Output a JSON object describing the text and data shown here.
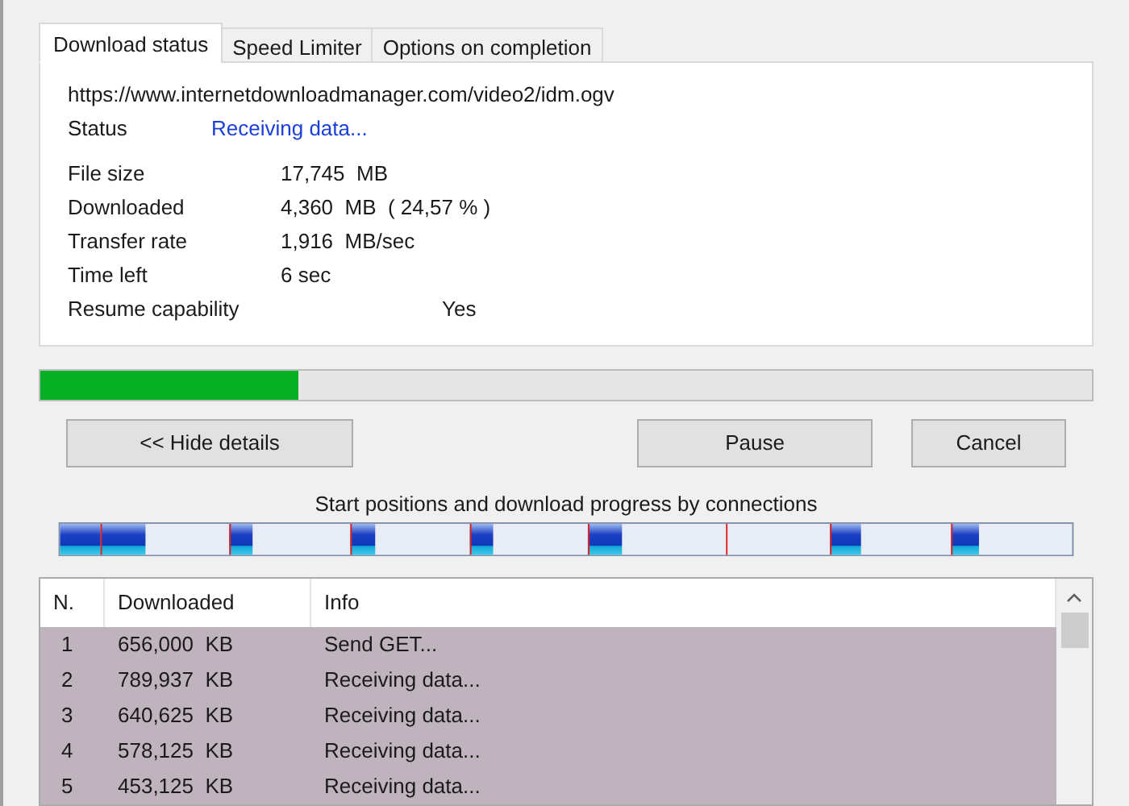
{
  "tabs": [
    {
      "label": "Download status",
      "selected": true
    },
    {
      "label": "Speed Limiter",
      "selected": false
    },
    {
      "label": "Options on completion",
      "selected": false
    }
  ],
  "url": "https://www.internetdownloadmanager.com/video2/idm.ogv",
  "status": {
    "label": "Status",
    "value": "Receiving data..."
  },
  "details": [
    {
      "label": "File size",
      "value": "17,745  MB"
    },
    {
      "label": "Downloaded",
      "value": "4,360  MB  ( 24,57 % )"
    },
    {
      "label": "Transfer rate",
      "value": "1,916  MB/sec"
    },
    {
      "label": "Time left",
      "value": "6 sec"
    },
    {
      "label": "Resume capability",
      "value": "Yes",
      "kind": "centered"
    }
  ],
  "progress": {
    "level": 0.2457
  },
  "buttons": [
    {
      "label": "<< Hide details"
    },
    {
      "label": "Pause"
    },
    {
      "label": "Cancel"
    }
  ],
  "connections_label": "Start positions and download progress by connections",
  "table": {
    "columns": [
      "N.",
      "Downloaded",
      "Info"
    ],
    "rows": [
      {
        "cells": [
          "1",
          "656,000  KB",
          "Send GET..."
        ],
        "selected": true
      },
      {
        "cells": [
          "2",
          "789,937  KB",
          "Receiving data..."
        ],
        "selected": true
      },
      {
        "cells": [
          "3",
          "640,625  KB",
          "Receiving data..."
        ],
        "selected": true
      },
      {
        "cells": [
          "4",
          "578,125  KB",
          "Receiving data..."
        ],
        "selected": true
      },
      {
        "cells": [
          "5",
          "453,125  KB",
          "Receiving data..."
        ],
        "selected": true
      }
    ]
  }
}
